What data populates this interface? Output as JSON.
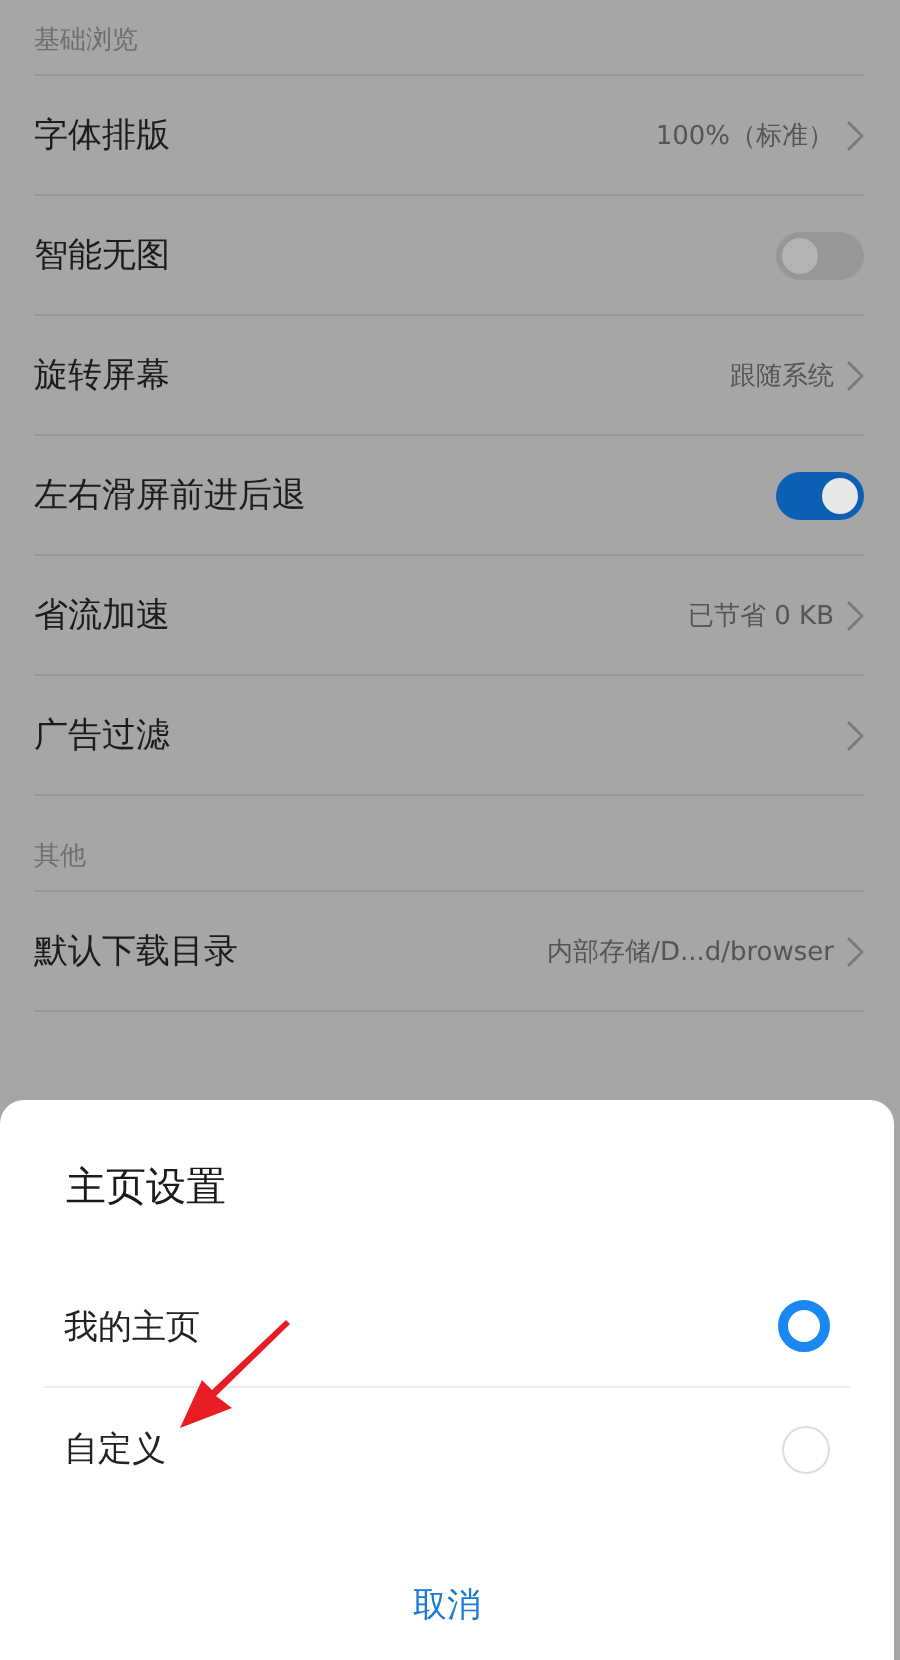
{
  "sections": [
    {
      "header": "基础浏览",
      "rows": [
        {
          "kind": "value",
          "label": "字体排版",
          "value": "100%（标准）"
        },
        {
          "kind": "toggle",
          "label": "智能无图",
          "on": false
        },
        {
          "kind": "value",
          "label": "旋转屏幕",
          "value": "跟随系统"
        },
        {
          "kind": "toggle",
          "label": "左右滑屏前进后退",
          "on": true
        },
        {
          "kind": "value",
          "label": "省流加速",
          "value": "已节省 0 KB"
        },
        {
          "kind": "link",
          "label": "广告过滤"
        }
      ]
    },
    {
      "header": "其他",
      "rows": [
        {
          "kind": "value",
          "label": "默认下载目录",
          "value": "内部存储/D...d/browser"
        },
        {
          "kind": "hidden"
        }
      ]
    }
  ],
  "dialog": {
    "title": "主页设置",
    "options": [
      {
        "label": "我的主页",
        "selected": true
      },
      {
        "label": "自定义",
        "selected": false
      }
    ],
    "cancel": "取消"
  }
}
